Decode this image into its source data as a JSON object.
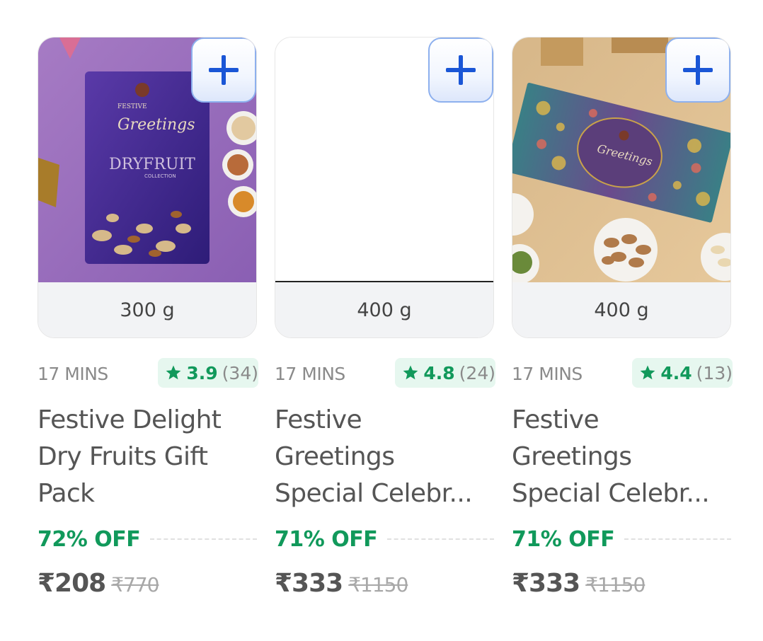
{
  "products": [
    {
      "weight": "300 g",
      "delivery": "17 MINS",
      "rating": "3.9",
      "rating_count": "(34)",
      "title": "Festive Delight\nDry Fruits Gift\nPack",
      "discount": "72% OFF",
      "price": "₹208",
      "mrp": "₹770",
      "image_lettering": [
        "Festive",
        "Greetings",
        "DRYFRUIT",
        "COLLECTION"
      ]
    },
    {
      "weight": "400 g",
      "delivery": "17 MINS",
      "rating": "4.8",
      "rating_count": "(24)",
      "title": "Festive\nGreetings\nSpecial Celebr...",
      "discount": "71% OFF",
      "price": "₹333",
      "mrp": "₹1150"
    },
    {
      "weight": "400 g",
      "delivery": "17 MINS",
      "rating": "4.4",
      "rating_count": "(13)",
      "title": "Festive\nGreetings\nSpecial Celebr...",
      "discount": "71% OFF",
      "price": "₹333",
      "mrp": "₹1150",
      "image_lettering": [
        "Greetings"
      ]
    }
  ],
  "colors": {
    "accent_green": "#11995b",
    "rating_bg": "#e6f7ef",
    "add_blue": "#1a56d6",
    "add_border": "#8db0ee"
  },
  "icons": {
    "add": "plus-icon",
    "rating": "star-icon"
  }
}
